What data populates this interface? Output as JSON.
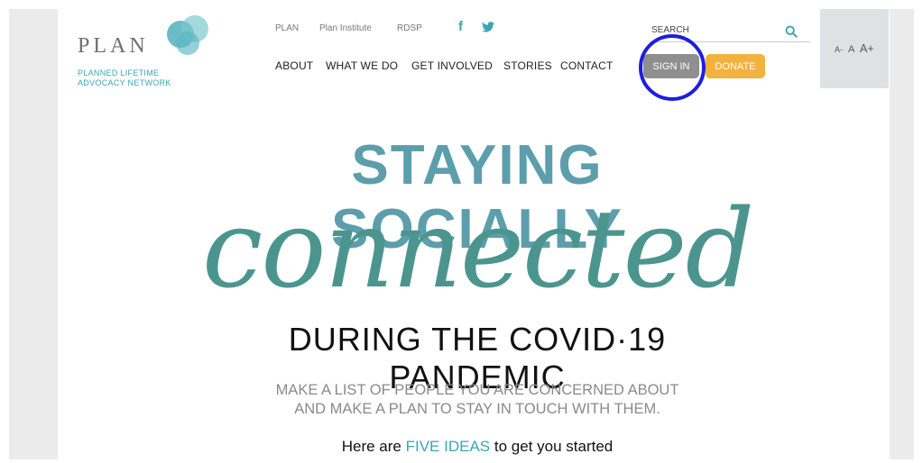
{
  "logo": {
    "word": "PLAN",
    "sub_line1": "PLANNED LIFETIME",
    "sub_line2": "ADVOCACY NETWORK"
  },
  "utility_links": [
    "PLAN",
    "Plan Institute",
    "RDSP"
  ],
  "social": {
    "facebook": "f",
    "twitter": "twitter-icon"
  },
  "nav": [
    "ABOUT",
    "WHAT WE DO",
    "GET INVOLVED",
    "STORIES",
    "CONTACT"
  ],
  "search": {
    "label": "SEARCH"
  },
  "buttons": {
    "sign_in": "SIGN IN",
    "donate": "DONATE"
  },
  "text_size": {
    "small": "A-",
    "normal": "A",
    "large": "A+"
  },
  "hero": {
    "title": "STAYING SOCIALLY",
    "script": "connected",
    "subtitle": "DURING THE COVID·19 PANDEMIC",
    "tagline_line1": "MAKE A LIST OF PEOPLE YOU ARE CONCERNED ABOUT",
    "tagline_line2": "AND MAKE A PLAN TO STAY IN TOUCH WITH THEM.",
    "intro_before": "Here are",
    "intro_link": "FIVE IDEAS",
    "intro_after": "to get you started"
  },
  "colors": {
    "accent": "#3aa6b3",
    "donate": "#f3b13e",
    "sign_in": "#8f8f8f",
    "highlight_ring": "#1c1ee0"
  }
}
